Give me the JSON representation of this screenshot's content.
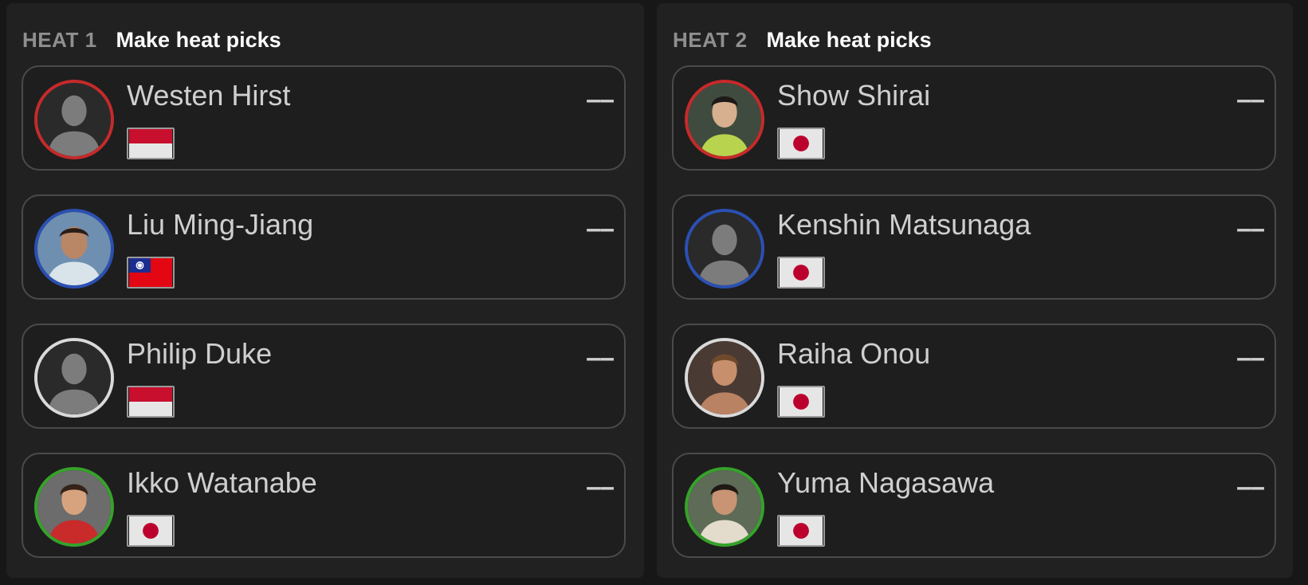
{
  "heats": [
    {
      "label": "HEAT 1",
      "cta": "Make heat picks",
      "surfers": [
        {
          "name": "Westen Hirst",
          "pick": "––",
          "ring": "red",
          "avatar": "silhouette-icon",
          "flag": "indonesia-flag-icon"
        },
        {
          "name": "Liu Ming-Jiang",
          "pick": "––",
          "ring": "blue",
          "avatar": "athlete-photo",
          "flag": "taiwan-flag-icon"
        },
        {
          "name": "Philip Duke",
          "pick": "––",
          "ring": "white",
          "avatar": "silhouette-icon",
          "flag": "indonesia-flag-icon"
        },
        {
          "name": "Ikko Watanabe",
          "pick": "––",
          "ring": "green",
          "avatar": "athlete-photo",
          "flag": "japan-flag-icon"
        }
      ]
    },
    {
      "label": "HEAT 2",
      "cta": "Make heat picks",
      "surfers": [
        {
          "name": "Show Shirai",
          "pick": "––",
          "ring": "red",
          "avatar": "athlete-photo",
          "flag": "japan-flag-icon"
        },
        {
          "name": "Kenshin Matsunaga",
          "pick": "––",
          "ring": "blue",
          "avatar": "silhouette-icon",
          "flag": "japan-flag-icon"
        },
        {
          "name": "Raiha Onou",
          "pick": "––",
          "ring": "white",
          "avatar": "athlete-photo",
          "flag": "japan-flag-icon"
        },
        {
          "name": "Yuma Nagasawa",
          "pick": "––",
          "ring": "green",
          "avatar": "athlete-photo",
          "flag": "japan-flag-icon"
        }
      ]
    }
  ],
  "colors": {
    "background": "#171717",
    "panel": "#212121",
    "ring_red": "#c62a2a",
    "ring_blue": "#2b50b3",
    "ring_white": "#d9d9d9",
    "ring_green": "#36a22a",
    "cta": "#ffffff",
    "heat_label": "#8f8f8f"
  }
}
